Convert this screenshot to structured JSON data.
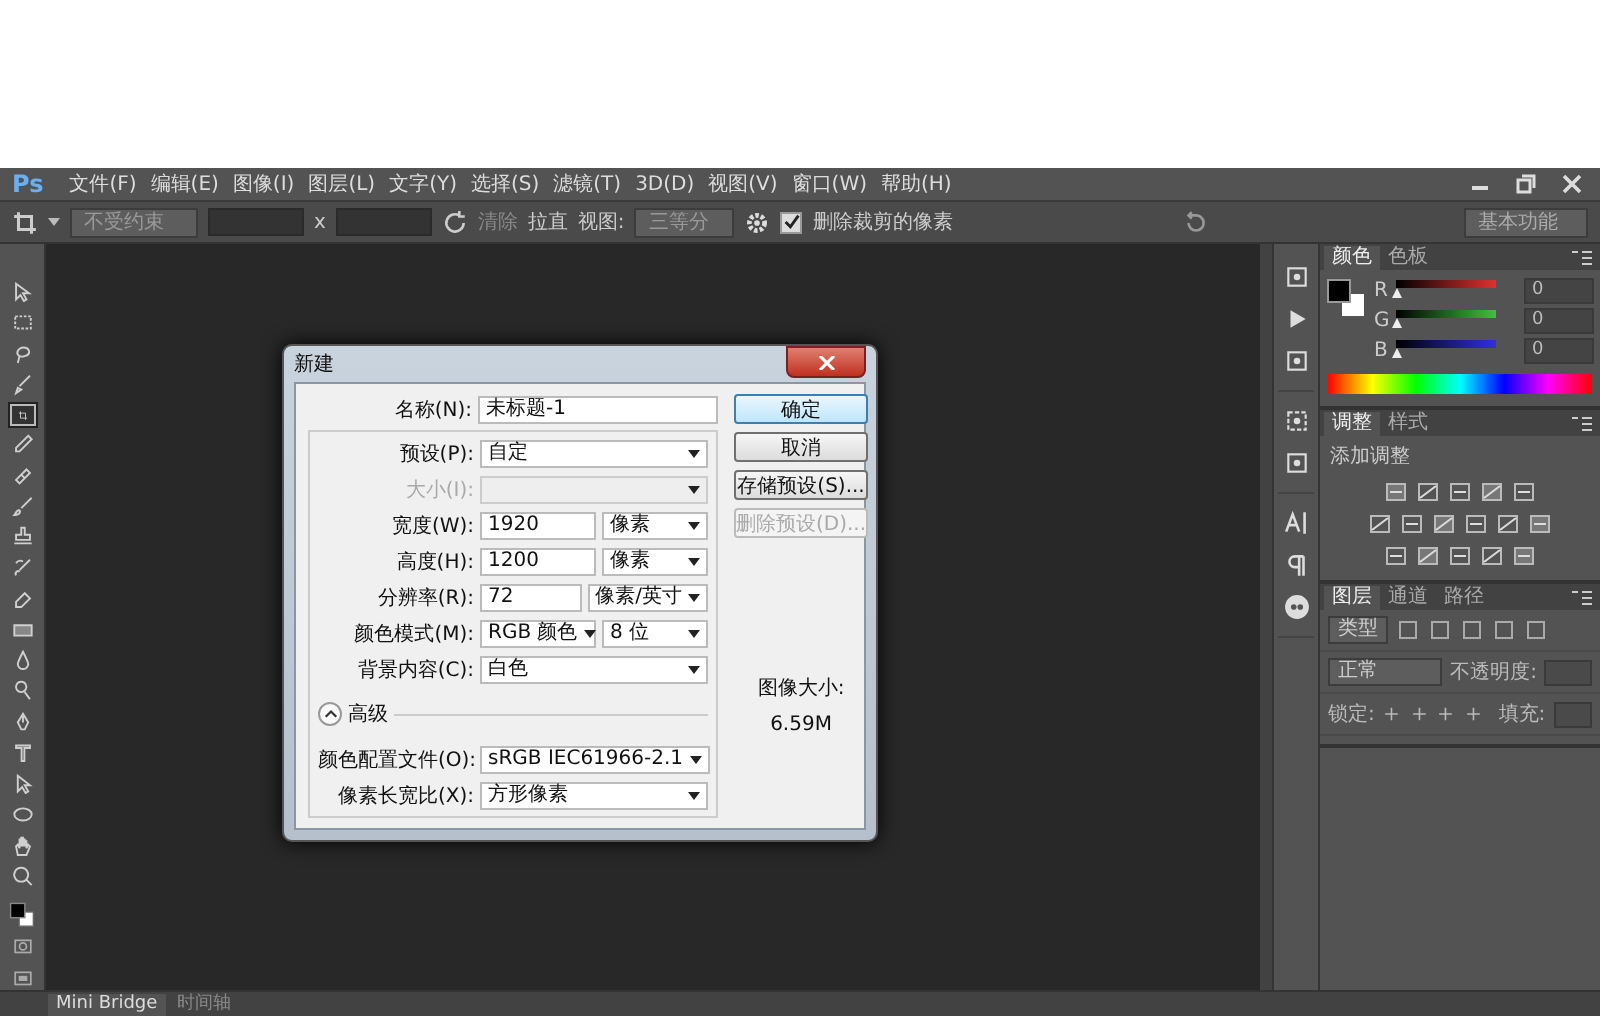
{
  "menu_bar": {
    "logo": "Ps",
    "items": [
      "文件(F)",
      "编辑(E)",
      "图像(I)",
      "图层(L)",
      "文字(Y)",
      "选择(S)",
      "滤镜(T)",
      "3D(D)",
      "视图(V)",
      "窗口(W)",
      "帮助(H)"
    ]
  },
  "options_bar": {
    "ratio": "不受约束",
    "x_separator": "x",
    "clear": "清除",
    "straighten": "拉直",
    "view_label": "视图:",
    "view_value": "三等分",
    "delete_cropped": {
      "label": "删除裁剪的像素",
      "checked": true
    },
    "workspace": "基本功能"
  },
  "toolbar": {
    "tools": [
      {
        "selected": false
      },
      {
        "selected": false
      },
      {
        "selected": false
      },
      {
        "selected": false
      },
      {
        "selected": true
      },
      {
        "selected": false
      },
      {
        "selected": false
      },
      {
        "selected": false
      },
      {
        "selected": false
      },
      {
        "selected": false
      },
      {
        "selected": false
      },
      {
        "selected": false
      },
      {
        "selected": false
      },
      {
        "selected": false
      },
      {
        "selected": false
      },
      {
        "selected": false
      },
      {
        "selected": false
      },
      {
        "selected": false
      },
      {
        "selected": false
      },
      {
        "selected": false
      }
    ]
  },
  "dialog": {
    "title": "新建",
    "rows": [
      {
        "label": "名称(N):",
        "kind": "text",
        "value": "未标题-1",
        "disabled": false
      },
      {
        "label": "预设(P):",
        "kind": "select",
        "value": "自定",
        "disabled": false
      },
      {
        "label": "大小(I):",
        "kind": "select",
        "disabled": true
      },
      {
        "label": "宽度(W):",
        "kind": "text_unit",
        "value": "1920",
        "unit": "像素",
        "disabled": false
      },
      {
        "label": "高度(H):",
        "kind": "text_unit",
        "value": "1200",
        "unit": "像素",
        "disabled": false
      },
      {
        "label": "分辨率(R):",
        "kind": "text_unit",
        "value": "72",
        "unit": "像素/英寸",
        "disabled": false
      },
      {
        "label": "颜色模式(M):",
        "kind": "select_unit",
        "value": "RGB 颜色",
        "unit": "8 位",
        "disabled": false
      },
      {
        "label": "背景内容(C):",
        "kind": "select",
        "value": "白色",
        "disabled": false
      }
    ],
    "advanced": {
      "label": "高级",
      "expanded": true
    },
    "advanced_rows": [
      {
        "label": "颜色配置文件(O):",
        "kind": "select",
        "value": "sRGB IEC61966-2.1",
        "disabled": false
      },
      {
        "label": "像素长宽比(X):",
        "kind": "select",
        "value": "方形像素",
        "disabled": false
      }
    ],
    "buttons": [
      {
        "label": "确定",
        "default": true,
        "disabled": false
      },
      {
        "label": "取消",
        "default": false,
        "disabled": false
      },
      {
        "label": "存储预设(S)...",
        "default": false,
        "disabled": false
      },
      {
        "label": "删除预设(D)...",
        "default": false,
        "disabled": true
      }
    ],
    "image_size_label": "图像大小:",
    "image_size_value": "6.59M"
  },
  "panels": {
    "color": {
      "tabs": [
        {
          "label": "颜色",
          "selected": true
        },
        {
          "label": "色板",
          "selected": false
        }
      ],
      "channels": [
        {
          "name": "R",
          "level": 0,
          "value": "0"
        },
        {
          "name": "G",
          "level": 0,
          "value": "0"
        },
        {
          "name": "B",
          "level": 0,
          "value": "0"
        }
      ]
    },
    "adjustments": {
      "tabs": [
        {
          "label": "调整",
          "selected": true
        },
        {
          "label": "样式",
          "selected": false
        }
      ],
      "heading": "添加调整"
    },
    "layers": {
      "tabs": [
        {
          "label": "图层",
          "selected": true
        },
        {
          "label": "通道",
          "selected": false
        },
        {
          "label": "路径",
          "selected": false
        }
      ],
      "filter": "类型",
      "blend_mode": "正常",
      "opacity_label": "不透明度:",
      "lock_label": "锁定:",
      "fill_label": "填充:"
    }
  },
  "bottom_tabs": [
    {
      "label": "Mini Bridge",
      "selected": true
    },
    {
      "label": "时间轴",
      "selected": false
    }
  ]
}
